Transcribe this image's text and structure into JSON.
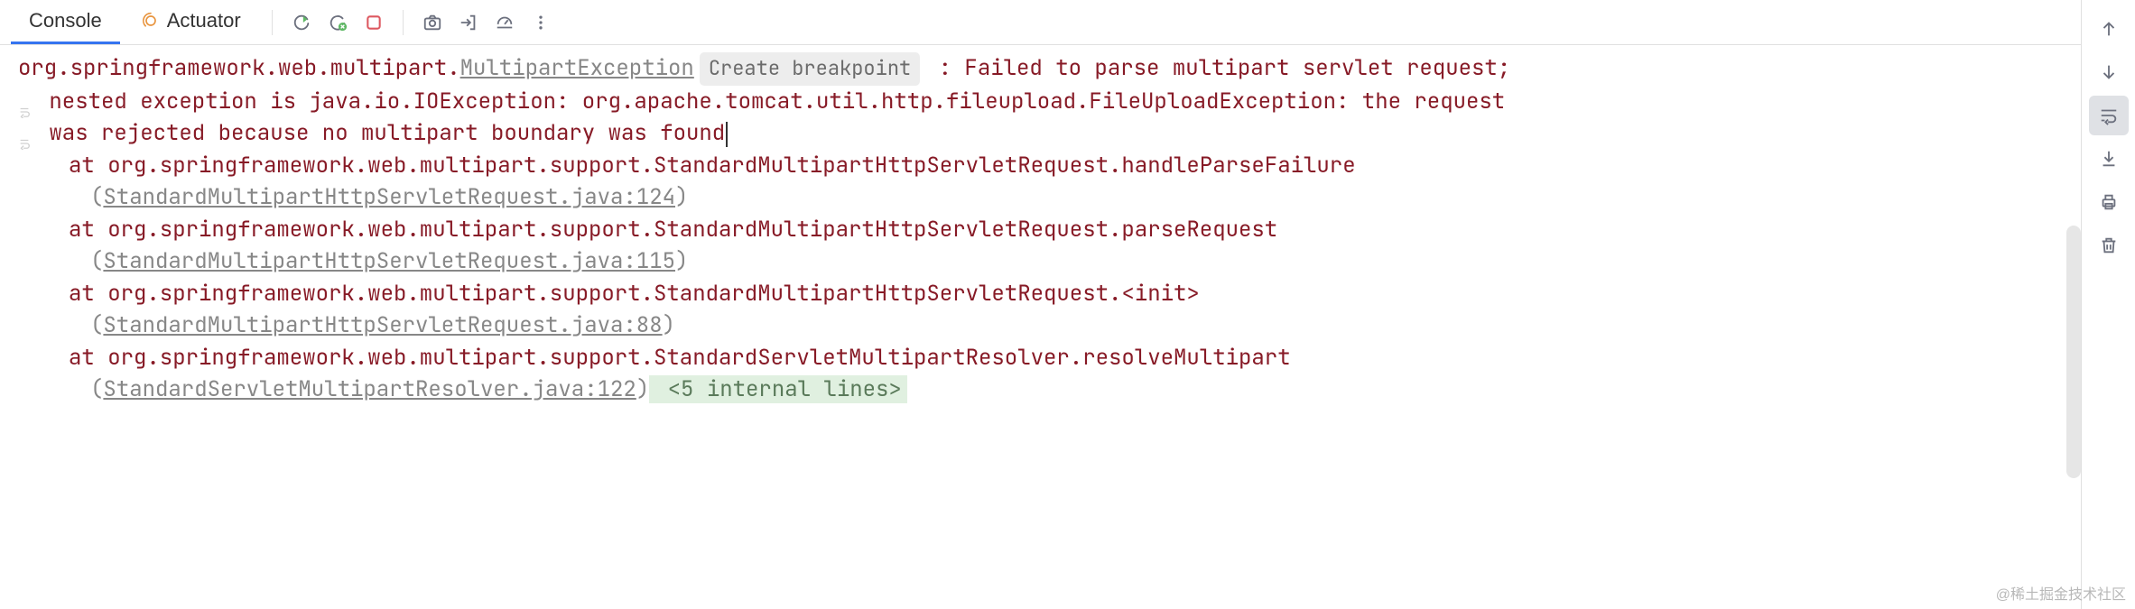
{
  "tabs": {
    "console": "Console",
    "actuator": "Actuator"
  },
  "toolbar": {
    "icons": {
      "rerun": "rerun-icon",
      "rerun_failed": "rerun-failed-icon",
      "stop": "stop-icon",
      "camera": "camera-icon",
      "exit": "exit-icon",
      "dashboard": "dashboard-icon",
      "more": "more-icon"
    }
  },
  "console": {
    "exception_prefix": "org.springframework.web.multipart.",
    "exception_class": "MultipartException",
    "breakpoint_label": "Create breakpoint",
    "message_part1": " : Failed to parse multipart servlet request;",
    "message_line2_pre": " nested exception is java.io.IOException: org.apache.tomcat.util.http.fileupload.FileUploadException: the request",
    "message_line3_pre": " was rejected because no multipart boundary was found",
    "stack": [
      {
        "at": "at org.springframework.web.multipart.support.StandardMultipartHttpServletRequest.handleParseFailure",
        "loc_open": "(",
        "loc_link": "StandardMultipartHttpServletRequest.java:124",
        "loc_close": ")"
      },
      {
        "at": "at org.springframework.web.multipart.support.StandardMultipartHttpServletRequest.parseRequest",
        "loc_open": "(",
        "loc_link": "StandardMultipartHttpServletRequest.java:115",
        "loc_close": ")"
      },
      {
        "at": "at org.springframework.web.multipart.support.StandardMultipartHttpServletRequest.<init>",
        "loc_open": "(",
        "loc_link": "StandardMultipartHttpServletRequest.java:88",
        "loc_close": ")"
      },
      {
        "at": "at org.springframework.web.multipart.support.StandardServletMultipartResolver.resolveMultipart",
        "loc_open": "(",
        "loc_link": "StandardServletMultipartResolver.java:122",
        "loc_close": ")",
        "collapsed": " <5 internal lines>"
      }
    ]
  },
  "side": {
    "icons": {
      "up": "arrow-up-icon",
      "down": "arrow-down-icon",
      "softwrap": "soft-wrap-icon",
      "scroll_end": "scroll-end-icon",
      "print": "print-icon",
      "trash": "trash-icon"
    }
  },
  "watermark": "@稀土掘金技术社区"
}
